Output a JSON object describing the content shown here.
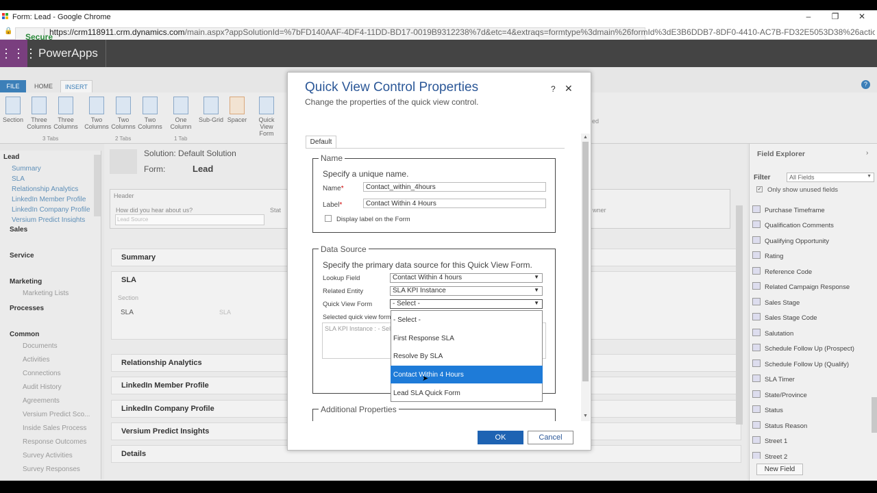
{
  "browser": {
    "tab_title": "Form: Lead - Google Chrome",
    "secure_label": "Secure",
    "url_host": "https://crm118911.crm.dynamics.com",
    "url_path": "/main.aspx?appSolutionId=%7bFD140AAF-4DF4-11DD-BD17-0019B9312238%7d&etc=4&extraqs=formtype%3dmain%26formId%3dE3B6DDB7-8DF0-4410-AC7B-FD32E5053D38%26action%3d-1..."
  },
  "app": {
    "name": "PowerApps"
  },
  "ribbon": {
    "tabs": [
      "FILE",
      "HOME",
      "INSERT"
    ],
    "buttons": [
      {
        "label": "Section"
      },
      {
        "label": "Three Columns"
      },
      {
        "label": "Three Columns"
      },
      {
        "label": "Two Columns"
      },
      {
        "label": "Two Columns"
      },
      {
        "label": "Two Columns"
      },
      {
        "label": "One Column"
      },
      {
        "label": "Sub-Grid"
      },
      {
        "label": "Spacer"
      },
      {
        "label": "Quick View Form"
      }
    ],
    "groups": [
      "3 Tabs",
      "2 Tabs",
      "1 Tab"
    ],
    "partial": "ed"
  },
  "leftnav": {
    "entity": "Lead",
    "entity_links": [
      "Summary",
      "SLA",
      "Relationship Analytics",
      "LinkedIn Member Profile",
      "LinkedIn Company Profile",
      "Versium Predict Insights"
    ],
    "groups": [
      "Sales",
      "Service",
      "Marketing",
      "Processes",
      "Common"
    ],
    "marketing_items": [
      "Marketing Lists"
    ],
    "common_items": [
      "Documents",
      "Activities",
      "Connections",
      "Audit History",
      "Agreements",
      "Versium Predict Sco...",
      "Inside Sales Process",
      "Response Outcomes",
      "Survey Activities",
      "Survey Responses"
    ]
  },
  "form": {
    "solution": "Solution: Default Solution",
    "form_label": "Form:",
    "form_name": "Lead",
    "header_label": "Header",
    "header_field": "How did you hear about us?",
    "header_field_value": "Lead Source",
    "header_field2": "Stat",
    "header_field3": "wner",
    "sections": [
      "Summary",
      "SLA",
      "Relationship Analytics",
      "LinkedIn Member Profile",
      "LinkedIn Company Profile",
      "Versium Predict Insights",
      "Details"
    ],
    "sla_section_label": "Section",
    "sla_field_label": "SLA",
    "sla_field_value": "SLA"
  },
  "field_explorer": {
    "title": "Field Explorer",
    "filter_label": "Filter",
    "filter_value": "All Fields",
    "unused_label": "Only show unused fields",
    "fields": [
      "Purchase Timeframe",
      "Qualification Comments",
      "Qualifying Opportunity",
      "Rating",
      "Reference Code",
      "Related Campaign Response",
      "Sales Stage",
      "Sales Stage Code",
      "Salutation",
      "Schedule Follow Up (Prospect)",
      "Schedule Follow Up (Qualify)",
      "SLA Timer",
      "State/Province",
      "Status",
      "Status Reason",
      "Street 1",
      "Street 2"
    ],
    "new_field_button": "New Field"
  },
  "dialog": {
    "title": "Quick View Control Properties",
    "subtitle": "Change the properties of the quick view control.",
    "help": "?",
    "close": "✕",
    "tab": "Default",
    "name_section": {
      "legend": "Name",
      "hint": "Specify a unique name.",
      "name_label": "Name",
      "name_value": "Contact_within_4hours",
      "label_label": "Label",
      "label_value": "Contact Within 4 Hours",
      "display_label": "Display label on the Form"
    },
    "data_source": {
      "legend": "Data Source",
      "hint": "Specify the primary data source for this Quick View Form.",
      "lookup_label": "Lookup Field",
      "lookup_value": "Contact Within 4 hours",
      "entity_label": "Related Entity",
      "entity_value": "SLA KPI Instance",
      "qvf_label": "Quick View Form",
      "qvf_value": "- Select -",
      "selected_label": "Selected quick view form",
      "selected_value": "SLA KPI Instance : - Sele"
    },
    "dropdown_options": [
      "- Select -",
      "First Response SLA",
      "Resolve By SLA",
      "Contact Within 4 Hours",
      "Lead SLA Quick Form"
    ],
    "highlighted_option": "Contact Within 4 Hours",
    "additional_legend": "Additional Properties",
    "ok": "OK",
    "cancel": "Cancel"
  }
}
